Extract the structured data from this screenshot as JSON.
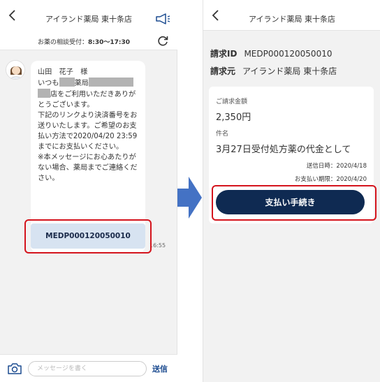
{
  "chat": {
    "header_title": "アイランド薬局 東十条店",
    "hours_label": "お薬の相談受付：",
    "hours_value": "8:30〜17:30",
    "message": {
      "line1": "山田　花子　様",
      "line2a": "いつも",
      "line2b": "薬局",
      "line3": "店をご利用いただきありがとうございます。",
      "line4": "下記のリンクより決済番号をお送りいたします。ご希望のお支払い方法で2020/04/20 23:59 までにお支払いください。",
      "line5": "※本メッセージにお心あたりがない場合、薬局までご連絡ください。"
    },
    "link_button_label": "MEDP000120050010",
    "message_time": "16:55",
    "input_placeholder": "メッセージを書く",
    "send_label": "送信"
  },
  "billing": {
    "header_title": "アイランド薬局 東十条店",
    "id_label": "請求ID",
    "id_value": "MEDP000120050010",
    "from_label": "請求元",
    "from_value": "アイランド薬局 東十条店",
    "amount_label": "ご請求金額",
    "amount_value": "2,350円",
    "item_label": "件名",
    "item_value": "3月27日受付処方薬の代金として",
    "sent_label": "送信日時：",
    "sent_value": "2020/4/18",
    "due_label": "お支払い期限：",
    "due_value": "2020/4/20",
    "pay_button_label": "支払い手続き"
  },
  "colors": {
    "accent_navy": "#0f2a52",
    "highlight_red": "#d4141d",
    "arrow_blue": "#4472c4",
    "link_button_bg": "#d7e3f1"
  },
  "icons": [
    "back-icon",
    "megaphone-icon",
    "refresh-icon",
    "camera-icon",
    "arrow-right-icon"
  ]
}
